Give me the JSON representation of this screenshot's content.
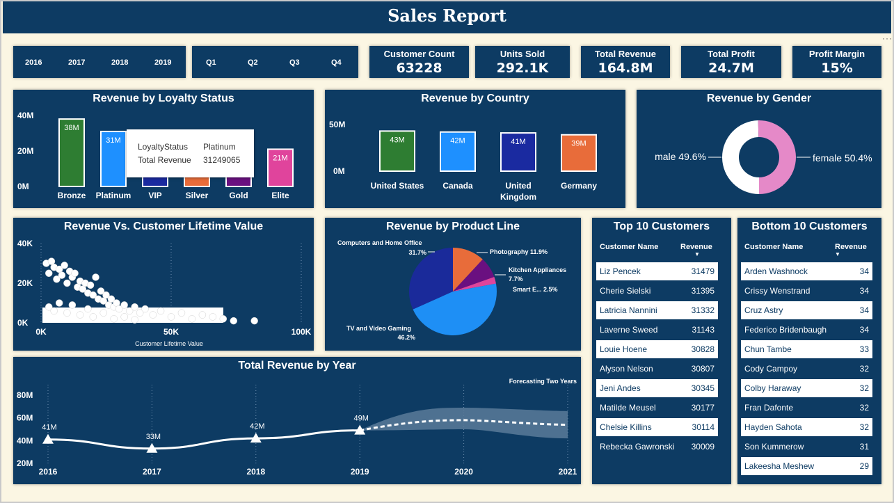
{
  "header": {
    "title": "Sales Report"
  },
  "years": [
    "2016",
    "2017",
    "2018",
    "2019"
  ],
  "quarters": [
    "Q1",
    "Q2",
    "Q3",
    "Q4"
  ],
  "kpis": [
    {
      "label": "Customer Count",
      "value": "63228"
    },
    {
      "label": "Units Sold",
      "value": "292.1K"
    },
    {
      "label": "Total Revenue",
      "value": "164.8M"
    },
    {
      "label": "Total Profit",
      "value": "24.7M"
    },
    {
      "label": "Profit Margin",
      "value": "15%"
    }
  ],
  "loyalty_title": "Revenue by Loyalty Status",
  "country_title": "Revenue by Country",
  "gender_title": "Revenue by Gender",
  "clv_title": "Revenue Vs. Customer Lifetime Value",
  "product_title": "Revenue by Product Line",
  "year_title": "Total Revenue by Year",
  "tooltip": {
    "k1": "LoyaltyStatus",
    "v1": "Platinum",
    "k2": "Total Revenue",
    "v2": "31249065"
  },
  "top10": {
    "title": "Top 10 Customers",
    "col1": "Customer Name",
    "col2": "Revenue",
    "rows": [
      {
        "name": "Liz Pencek",
        "rev": "31479"
      },
      {
        "name": "Cherie Sielski",
        "rev": "31395"
      },
      {
        "name": "Latricia Nannini",
        "rev": "31332"
      },
      {
        "name": "Laverne Sweed",
        "rev": "31143"
      },
      {
        "name": "Louie Hoene",
        "rev": "30828"
      },
      {
        "name": "Alyson Nelson",
        "rev": "30807"
      },
      {
        "name": "Jeni Andes",
        "rev": "30345"
      },
      {
        "name": "Matilde Meusel",
        "rev": "30177"
      },
      {
        "name": "Chelsie Killins",
        "rev": "30114"
      },
      {
        "name": "Rebecka Gawronski",
        "rev": "30009"
      }
    ]
  },
  "bottom10": {
    "title": "Bottom 10 Customers",
    "col1": "Customer Name",
    "col2": "Revenue",
    "rows": [
      {
        "name": "Arden Washnock",
        "rev": "34"
      },
      {
        "name": "Crissy Wenstrand",
        "rev": "34"
      },
      {
        "name": "Cruz Astry",
        "rev": "34"
      },
      {
        "name": "Federico Bridenbaugh",
        "rev": "34"
      },
      {
        "name": "Chun Tambe",
        "rev": "33"
      },
      {
        "name": "Cody Campoy",
        "rev": "32"
      },
      {
        "name": "Colby Haraway",
        "rev": "32"
      },
      {
        "name": "Fran Dafonte",
        "rev": "32"
      },
      {
        "name": "Hayden Sahota",
        "rev": "32"
      },
      {
        "name": "Son Kummerow",
        "rev": "31"
      },
      {
        "name": "Lakeesha Meshew",
        "rev": "29"
      }
    ]
  },
  "chart_data": [
    {
      "type": "bar",
      "title": "Revenue by Loyalty Status",
      "categories": [
        "Bronze",
        "Platinum",
        "VIP",
        "Silver",
        "Gold",
        "Elite"
      ],
      "values": [
        38,
        31,
        27,
        26,
        25,
        21
      ],
      "data_labels": [
        "38M",
        "31M",
        "",
        "",
        "",
        "21M"
      ],
      "colors": [
        "#2e7d32",
        "#1e90ff",
        "#1a2aa0",
        "#e86c3a",
        "#6a1080",
        "#e0449c"
      ],
      "yticks": [
        "40M",
        "20M",
        "0M"
      ],
      "ylim": [
        0,
        40
      ]
    },
    {
      "type": "bar",
      "title": "Revenue by Country",
      "categories": [
        "United States",
        "Canada",
        "United Kingdom",
        "Germany"
      ],
      "values": [
        43,
        42,
        41,
        39
      ],
      "data_labels": [
        "43M",
        "42M",
        "41M",
        "39M"
      ],
      "colors": [
        "#2e7d32",
        "#1e90ff",
        "#1a2aa0",
        "#e86c3a"
      ],
      "yticks": [
        "50M",
        "0M"
      ],
      "ylim": [
        0,
        50
      ]
    },
    {
      "type": "pie",
      "title": "Revenue by Gender",
      "labels": [
        "male 49.6%",
        "female 50.4%"
      ],
      "values": [
        49.6,
        50.4
      ],
      "colors": [
        "#ffffff",
        "#e589c8"
      ]
    },
    {
      "type": "scatter",
      "title": "Revenue Vs. Customer Lifetime Value",
      "xlabel": "Customer Lifetime Value",
      "xticks": [
        "0K",
        "50K",
        "100K"
      ],
      "yticks": [
        "40K",
        "20K",
        "0K"
      ],
      "xlim": [
        0,
        100000
      ],
      "ylim": [
        0,
        40000
      ],
      "points": [
        [
          2000,
          30000
        ],
        [
          3000,
          25000
        ],
        [
          4000,
          31000
        ],
        [
          5000,
          28000
        ],
        [
          6000,
          22000
        ],
        [
          7000,
          27000
        ],
        [
          8000,
          24000
        ],
        [
          9000,
          29000
        ],
        [
          10000,
          20000
        ],
        [
          11000,
          26000
        ],
        [
          12000,
          23000
        ],
        [
          13000,
          25000
        ],
        [
          14000,
          18000
        ],
        [
          15000,
          21000
        ],
        [
          16000,
          17000
        ],
        [
          17000,
          20000
        ],
        [
          18000,
          15000
        ],
        [
          19000,
          19000
        ],
        [
          20000,
          14000
        ],
        [
          21000,
          23000
        ],
        [
          22000,
          12000
        ],
        [
          23000,
          16000
        ],
        [
          24000,
          11000
        ],
        [
          25000,
          14000
        ],
        [
          26000,
          9000
        ],
        [
          27000,
          12000
        ],
        [
          28000,
          8000
        ],
        [
          29000,
          10000
        ],
        [
          30000,
          7000
        ],
        [
          32000,
          9000
        ],
        [
          34000,
          6000
        ],
        [
          36000,
          8000
        ],
        [
          38000,
          5000
        ],
        [
          40000,
          7000
        ],
        [
          43000,
          4000
        ],
        [
          46000,
          6000
        ],
        [
          50000,
          3000
        ],
        [
          54000,
          5000
        ],
        [
          58000,
          2000
        ],
        [
          62000,
          4000
        ],
        [
          66000,
          3000
        ],
        [
          70000,
          2000
        ],
        [
          74000,
          1000
        ],
        [
          82000,
          1000
        ],
        [
          3000,
          8000
        ],
        [
          5000,
          6000
        ],
        [
          7000,
          10000
        ],
        [
          10000,
          5000
        ],
        [
          12000,
          9000
        ],
        [
          15000,
          4000
        ],
        [
          18000,
          7000
        ],
        [
          20000,
          3000
        ],
        [
          24000,
          5000
        ],
        [
          28000,
          2000
        ],
        [
          32000,
          3000
        ],
        [
          36000,
          1500
        ]
      ]
    },
    {
      "type": "pie",
      "title": "Revenue by Product Line",
      "labels": [
        "Computers and Home Office",
        "Photography",
        "Kitchen Appliances",
        "Smart E...",
        "TV and Video Gaming"
      ],
      "percents": [
        "31.7%",
        "11.9%",
        "7.7%",
        "2.5%",
        "46.2%"
      ],
      "values": [
        31.7,
        11.9,
        7.7,
        2.5,
        46.2
      ],
      "colors": [
        "#1a2a9a",
        "#e86c3a",
        "#6a1080",
        "#e0449c",
        "#1e8ff5"
      ]
    },
    {
      "type": "line",
      "title": "Total Revenue by Year",
      "x": [
        "2016",
        "2017",
        "2018",
        "2019",
        "2020",
        "2021"
      ],
      "values": [
        41,
        33,
        42,
        49
      ],
      "data_labels": [
        "41M",
        "33M",
        "42M",
        "49M"
      ],
      "forecast": {
        "label": "Forecasting Two Years",
        "x": [
          "2019",
          "2020",
          "2021"
        ],
        "values": [
          49,
          58,
          54
        ],
        "upper": [
          49,
          69,
          66
        ],
        "lower": [
          49,
          50,
          42
        ]
      },
      "yticks": [
        "80M",
        "60M",
        "40M",
        "20M"
      ],
      "ylim": [
        20,
        80
      ]
    }
  ]
}
